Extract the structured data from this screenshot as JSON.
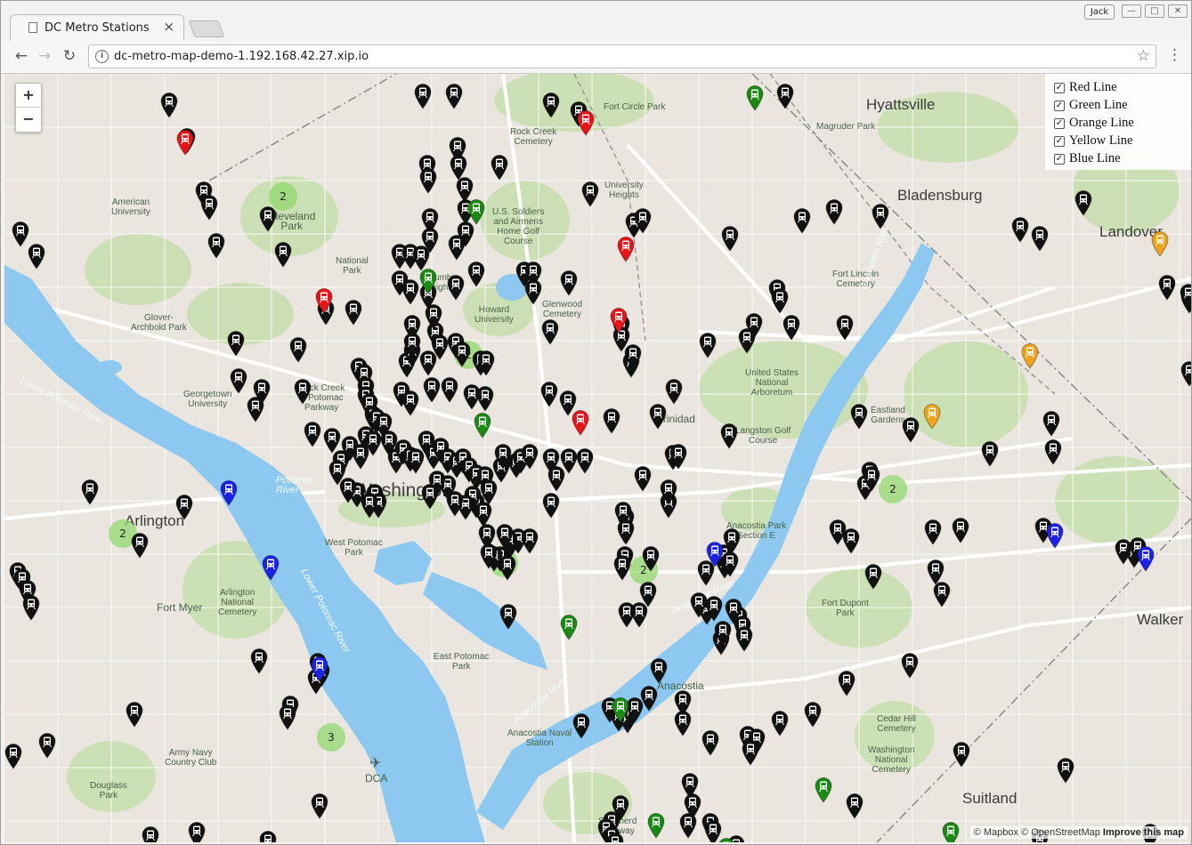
{
  "browser": {
    "tab_title": "DC Metro Stations",
    "tab_close": "×",
    "user_name": "Jack",
    "win_min": "—",
    "win_max": "□",
    "win_close": "✕",
    "url": "dc-metro-map-demo-1.192.168.42.27.xip.io",
    "info_icon": "i",
    "star_icon": "☆",
    "menu_icon": "⋮",
    "back_icon": "←",
    "forward_icon": "→",
    "reload_icon": "↻"
  },
  "map": {
    "zoom_in": "+",
    "zoom_out": "−",
    "legend": [
      {
        "label": "Red Line",
        "checked": true
      },
      {
        "label": "Green Line",
        "checked": true
      },
      {
        "label": "Orange Line",
        "checked": true
      },
      {
        "label": "Yellow Line",
        "checked": true
      },
      {
        "label": "Blue Line",
        "checked": true
      }
    ],
    "check_mark": "✓",
    "attribution": {
      "prefix": "© Mapbox © OpenStreetMap",
      "improve": "Improve this map"
    },
    "places": {
      "hyattsville": "Hyattsville",
      "bladensburg": "Bladensburg",
      "landover": "Landover",
      "washington": "Washington",
      "arlington": "Arlington",
      "walker": "Walker",
      "suitland": "Suitland",
      "anacostia": "Anacostia",
      "fort_circle": "Fort Circle Park",
      "rock_creek_cem": "Rock Creek\nCemetery",
      "magruder": "Magruder Park",
      "university_heights": "University\nHeights",
      "american_univ": "American\nUniversity",
      "cleveland_park": "Cleveland\nPark",
      "national_park": "National\nPark",
      "soldiers_home": "U.S. Soldiers\nand Airmens\nHome Golf\nCourse",
      "glover": "Glover-\nArchbold Park",
      "columbia_heights": "Columbia\nHeights",
      "howard": "Howard\nUniversity",
      "glenwood": "Glenwood\nCemetery",
      "fort_lincoln": "Fort Lincoln\nCemetery",
      "arboretum": "United States\nNational\nArboretum",
      "georgetown": "Georgetown\nUniversity",
      "rock_creek_pkwy": "Rock Creek\n& Potomac\nParkway",
      "trinidad": "Trinidad",
      "langston": "Langston Golf\nCourse",
      "eastland": "Eastland\nGardens",
      "west_potomac": "West Potomac\nPark",
      "fort_myer": "Fort Myer",
      "arlington_cem": "Arlington\nNational\nCemetery",
      "east_potomac": "East Potomac\nPark",
      "anacostia_park": "Anacostia Park\nSection E",
      "fort_dupont": "Fort Dupont\nPark",
      "anacostia_naval": "Anacostia Naval\nStation",
      "cedar_hill": "Cedar Hill\nCemetery",
      "washington_national": "Washington\nNational\nCemetery",
      "army_navy": "Army Navy\nCountry Club",
      "douglass": "Douglass\nPark",
      "shepherd": "Shepherd\nParkway",
      "dca": "DCA",
      "lower_potomac": "Lower Potomac River",
      "lower_potomac2": "Lower Potomac River",
      "potomac": "Potomac\nRiver",
      "anacostia_river": "Anacostia River",
      "anacostia_river2": "Anacostia River",
      "anacostia_river3": "Anacostia River"
    },
    "clusters": [
      {
        "id": "c1",
        "count": "2"
      },
      {
        "id": "c2",
        "count": "2"
      },
      {
        "id": "c3",
        "count": "2"
      },
      {
        "id": "c4",
        "count": "2"
      },
      {
        "id": "c5",
        "count": "5"
      },
      {
        "id": "c6",
        "count": "2"
      },
      {
        "id": "c7",
        "count": "3"
      }
    ],
    "pin_colors": {
      "black": "#111111",
      "red": "#e8141a",
      "green": "#1a8a12",
      "blue": "#1c23e6",
      "orange": "#f0a31c"
    },
    "pin_icon_name": "train-icon"
  }
}
